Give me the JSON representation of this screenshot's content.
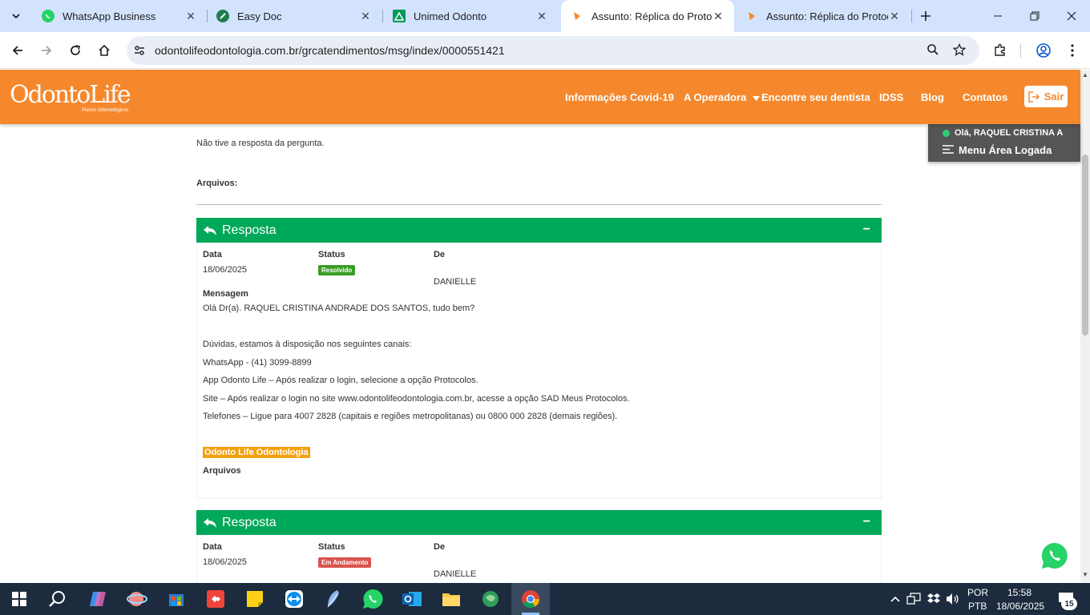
{
  "browser": {
    "tabs": [
      {
        "label": "WhatsApp Business",
        "icon": "whatsapp-icon"
      },
      {
        "label": "Easy Doc",
        "icon": "easydoc-icon"
      },
      {
        "label": "Unimed Odonto",
        "icon": "unimed-icon"
      },
      {
        "label": "Assunto: Réplica do Protocolo",
        "icon": "odontolife-icon",
        "active": true
      },
      {
        "label": "Assunto: Réplica do Protocolo",
        "icon": "odontolife-icon"
      }
    ],
    "url": "odontolifeodontologia.com.br/grcatendimentos/msg/index/0000551421"
  },
  "site": {
    "logo_text": "OdontoLife",
    "logo_sub": "Planos Odontológicos",
    "nav": [
      "Informações Covid-19",
      "A Operadora",
      "Encontre seu dentista",
      "IDSS",
      "Blog",
      "Contatos"
    ],
    "logout_label": "Sair",
    "user_greeting": "Olá, RAQUEL CRISTINA ANDRADE DOS SANTOS",
    "menu_label": "Menu Área Logada"
  },
  "message": {
    "previous_text": "Não tive a resposta da pergunta.",
    "files_label": "Arquivos:"
  },
  "responses": [
    {
      "title": "Resposta",
      "collapse_symbol": "−",
      "date_label": "Data",
      "date": "18/06/2025",
      "status_label": "Status",
      "status": "Resolvido",
      "status_color": "#3a9d23",
      "from_label": "De",
      "from": "DANIELLE",
      "message_label": "Mensagem",
      "lines": [
        "Olá Dr(a). RAQUEL CRISTINA ANDRADE DOS SANTOS, tudo bem?",
        "Dúvidas, estamos à disposição nos seguintes canais:",
        "WhatsApp - (41) 3099-8899",
        "App Odonto Life – Após realizar o login, selecione a opção Protocolos.",
        "Site – Após realizar o login no site www.odontolifeodontologia.com.br, acesse a opção SAD Meus Protocolos.",
        "Telefones – Ligue para 4007 2828 (capitais e regiões metropolitanas) ou 0800 000 2828 (demais regiões)."
      ],
      "signature": "Odonto Life Odontologia",
      "files_label": "Arquivos"
    },
    {
      "title": "Resposta",
      "collapse_symbol": "−",
      "date_label": "Data",
      "date": "18/06/2025",
      "status_label": "Status",
      "status": "Em Andamento",
      "status_color": "#d9534f",
      "from_label": "De",
      "from": "DANIELLE"
    }
  ],
  "taskbar": {
    "lang_line1": "POR",
    "lang_line2": "PTB",
    "time": "15:58",
    "date": "18/06/2025",
    "notification_count": "15"
  },
  "colors": {
    "brand_orange": "#f5882d",
    "response_green": "#00a859",
    "signature_orange": "#f5a00e"
  }
}
